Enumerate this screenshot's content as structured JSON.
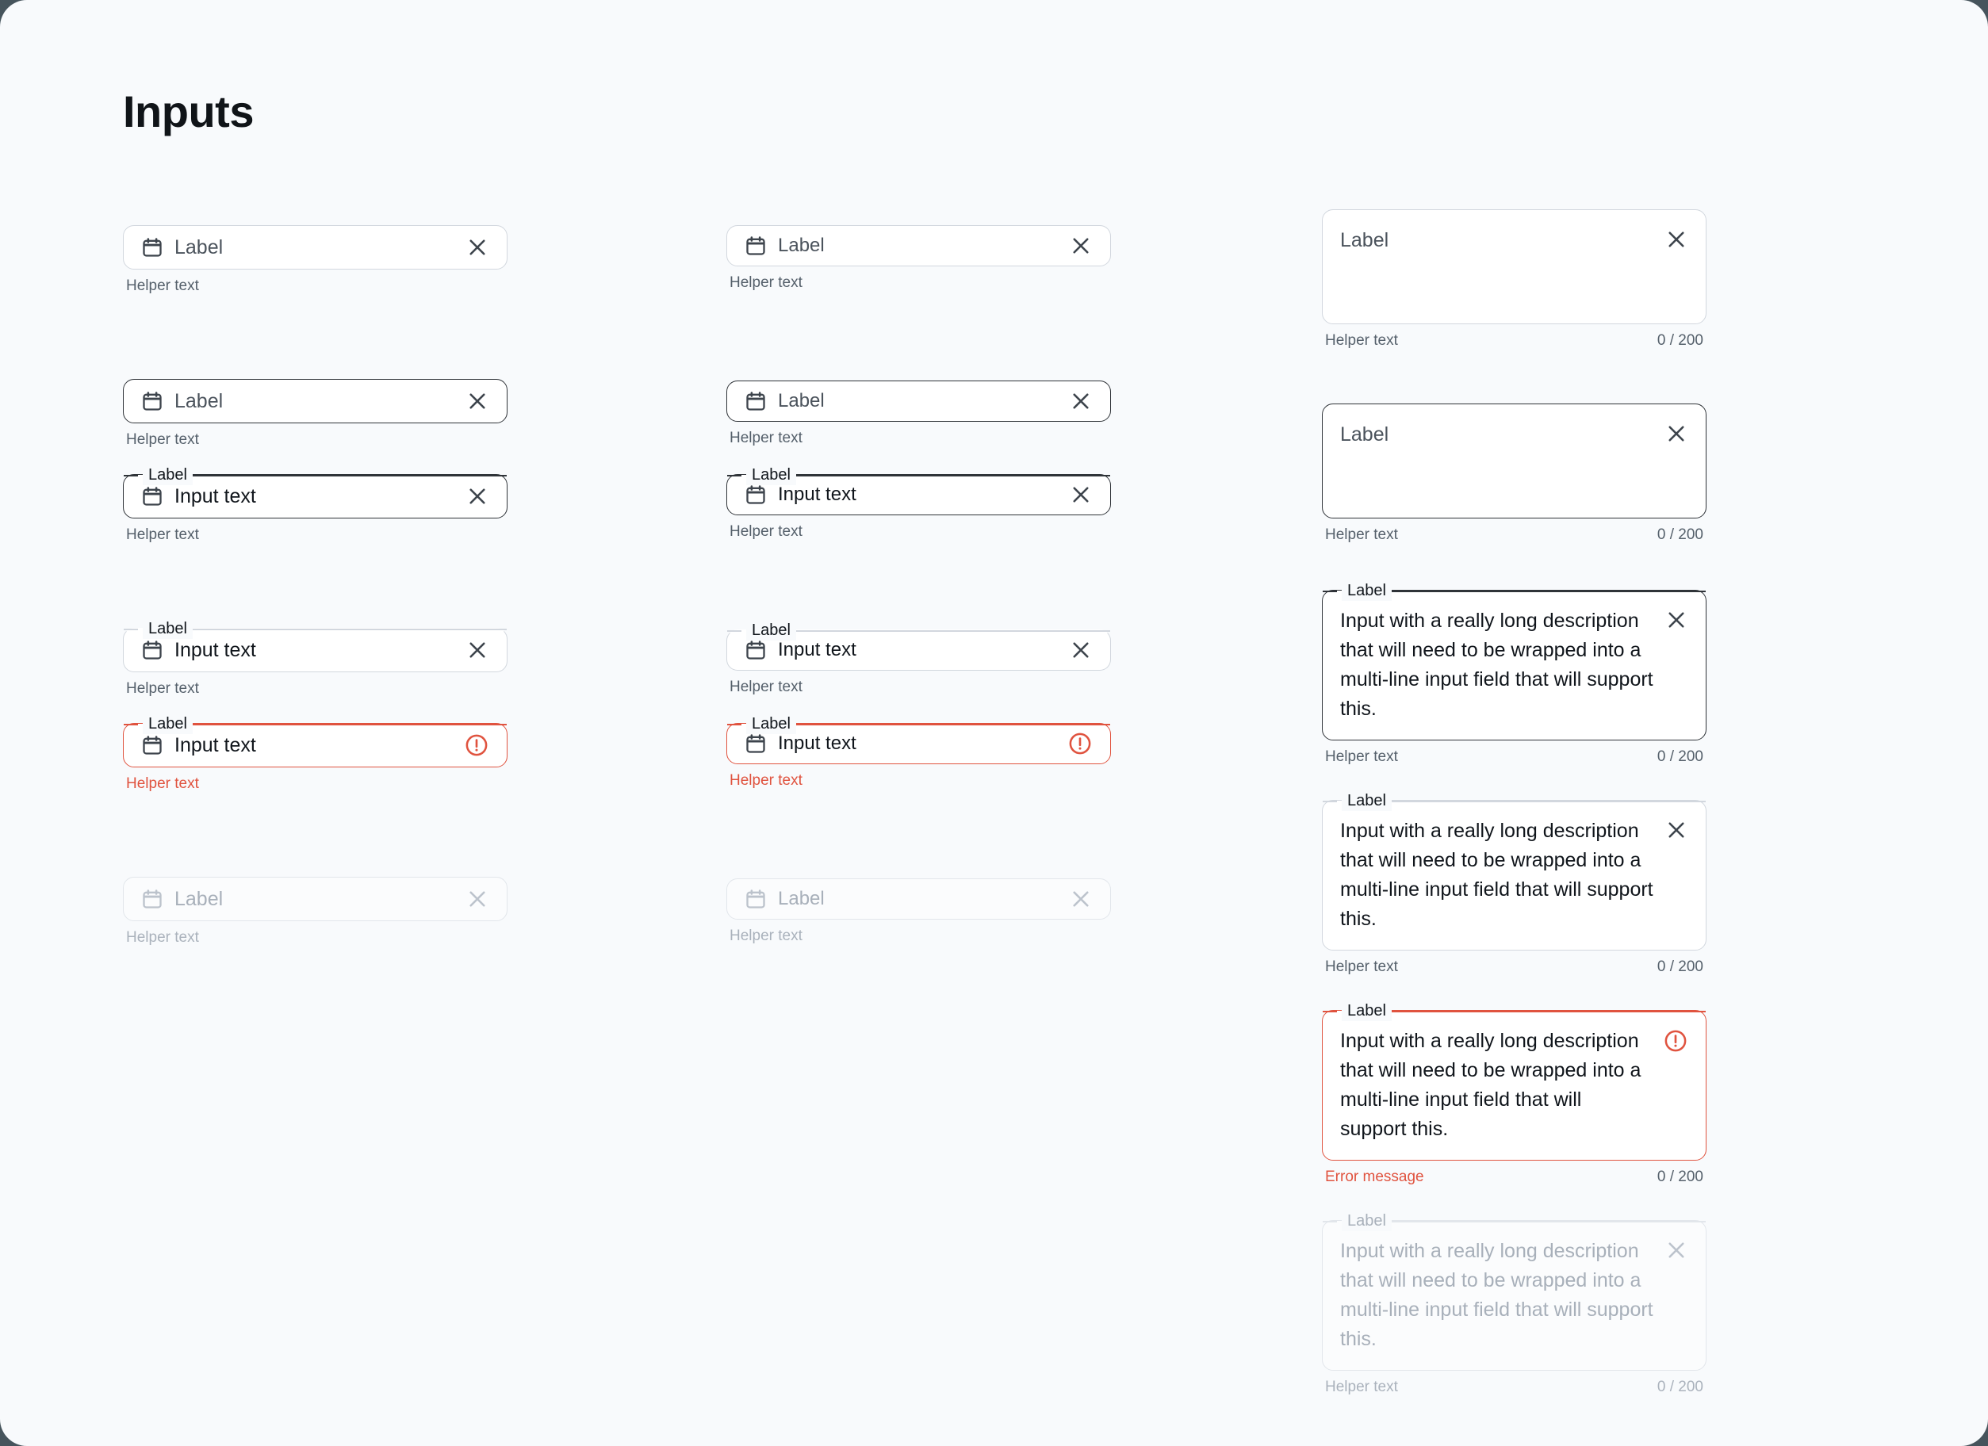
{
  "page": {
    "title": "Inputs",
    "background": "#f8fafc",
    "backdrop": "#46545c"
  },
  "colors": {
    "border_default": "#d2d7de",
    "border_strong": "#2f3338",
    "border_error": "#e0533f",
    "border_disabled": "#e2e6eb",
    "text_primary": "#10151b",
    "text_helper": "#55606b",
    "text_disabled": "#a8b0ba",
    "error": "#e0533f"
  },
  "common": {
    "label": "Label",
    "input_text": "Input text",
    "helper_text": "Helper text",
    "error_message": "Error message",
    "counter": "0 / 200",
    "long_text": "Input with a really long description that will need to be wrapped into a multi-line input field that will support this.",
    "calendar_icon": "calendar-icon",
    "clear_icon": "close-icon",
    "alert_icon": "alert-circle-icon"
  },
  "column_small": {
    "name": "single-line-inputs-large",
    "fields": [
      {
        "state": "rest",
        "label": "Label",
        "helper": "Helper text",
        "trailing": "close-icon",
        "floating": false
      },
      {
        "state": "hover",
        "label": "Label",
        "helper": "Helper text",
        "trailing": "close-icon",
        "floating": false
      },
      {
        "state": "focused",
        "label": "Label",
        "value": "Input text",
        "helper": "Helper text",
        "trailing": "close-icon",
        "floating": true
      },
      {
        "state": "filled",
        "label": "Label",
        "value": "Input text",
        "helper": "Helper text",
        "trailing": "close-icon",
        "floating": true
      },
      {
        "state": "error",
        "label": "Label",
        "value": "Input text",
        "helper": "Helper text",
        "trailing": "alert-circle-icon",
        "floating": true
      },
      {
        "state": "disabled",
        "label": "Label",
        "helper": "Helper text",
        "trailing": "close-icon",
        "floating": false
      }
    ]
  },
  "column_medium": {
    "name": "single-line-inputs-medium",
    "fields": [
      {
        "state": "rest",
        "label": "Label",
        "helper": "Helper text",
        "trailing": "close-icon",
        "floating": false
      },
      {
        "state": "hover",
        "label": "Label",
        "helper": "Helper text",
        "trailing": "close-icon",
        "floating": false
      },
      {
        "state": "focused",
        "label": "Label",
        "value": "Input text",
        "helper": "Helper text",
        "trailing": "close-icon",
        "floating": true
      },
      {
        "state": "filled",
        "label": "Label",
        "value": "Input text",
        "helper": "Helper text",
        "trailing": "close-icon",
        "floating": true
      },
      {
        "state": "error",
        "label": "Label",
        "value": "Input text",
        "helper": "Helper text",
        "trailing": "alert-circle-icon",
        "floating": true
      },
      {
        "state": "disabled",
        "label": "Label",
        "helper": "Helper text",
        "trailing": "close-icon",
        "floating": false
      }
    ]
  },
  "column_textarea": {
    "name": "multi-line-inputs",
    "fields": [
      {
        "state": "rest",
        "placeholder": "Label",
        "helper": "Helper text",
        "counter": "0 / 200",
        "trailing": "close-icon",
        "floating": false
      },
      {
        "state": "hover",
        "placeholder": "Label",
        "helper": "Helper text",
        "counter": "0 / 200",
        "trailing": "close-icon",
        "floating": false
      },
      {
        "state": "focused",
        "label": "Label",
        "value": "Input with a really long description that will need to be wrapped into a multi-line input field that will support this.",
        "helper": "Helper text",
        "counter": "0 / 200",
        "trailing": "close-icon",
        "floating": true
      },
      {
        "state": "filled",
        "label": "Label",
        "value": "Input with a really long description that will need to be wrapped into a multi-line input field that will support this.",
        "helper": "Helper text",
        "counter": "0 / 200",
        "trailing": "close-icon",
        "floating": true
      },
      {
        "state": "error",
        "label": "Label",
        "value": "Input with a really long description that will need to be wrapped into a multi-line input field that will support this.",
        "helper": "Error message",
        "counter": "0 / 200",
        "trailing": "alert-circle-icon",
        "floating": true
      },
      {
        "state": "disabled",
        "label": "Label",
        "value": "Input with a really long description that will need to be wrapped into a multi-line input field that will support this.",
        "helper": "Helper text",
        "counter": "0 / 200",
        "trailing": "close-icon",
        "floating": true
      }
    ]
  }
}
